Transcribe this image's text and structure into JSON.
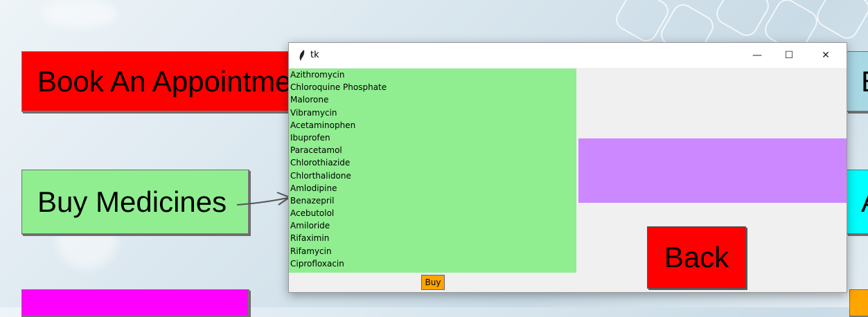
{
  "app": {
    "buttons": {
      "book": "Book An Appointment",
      "buy_medicines": "Buy Medicines",
      "right_top_letter": "B",
      "right_mid_letter": "A"
    },
    "colors": {
      "book": "#ff0000",
      "buy_medicines": "#90ee90",
      "bottom_left": "#ff00ff",
      "right_top": "#a8d8e4",
      "right_mid": "#00ffff",
      "right_bottom": "#ffa500"
    }
  },
  "window": {
    "title": "tk",
    "controls": {
      "minimize": "—",
      "maximize": "☐",
      "close": "✕"
    },
    "medicines": [
      "Azithromycin",
      "Chloroquine Phosphate",
      "Malorone",
      "Vibramycin",
      "Acetaminophen",
      "Ibuprofen",
      "Paracetamol",
      "Chlorothiazide",
      "Chlorthalidone",
      "Amlodipine",
      "Benazepril",
      "Acebutolol",
      "Amiloride",
      "Rifaximin",
      "Rifamycin",
      "Ciprofloxacin"
    ],
    "buy_label": "Buy",
    "back_label": "Back",
    "colors": {
      "listbox": "#90ee90",
      "purple": "#cc88ff",
      "back": "#ff0000",
      "buy": "#ffa500"
    }
  }
}
